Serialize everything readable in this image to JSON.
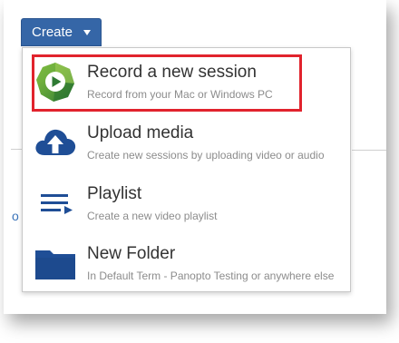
{
  "create_button": {
    "label": "Create"
  },
  "menu": {
    "items": [
      {
        "title": "Record a new session",
        "subtitle": "Record from your Mac or Windows PC",
        "icon": "panopto-play-icon"
      },
      {
        "title": "Upload media",
        "subtitle": "Create new sessions by uploading video or audio",
        "icon": "cloud-upload-icon"
      },
      {
        "title": "Playlist",
        "subtitle": "Create a new video playlist",
        "icon": "playlist-icon"
      },
      {
        "title": "New Folder",
        "subtitle": "In Default Term - Panopto Testing or anywhere else",
        "icon": "folder-icon"
      }
    ]
  },
  "background": {
    "fragment": "o"
  },
  "colors": {
    "button_blue": "#3566a7",
    "icon_blue": "#1f4e96",
    "highlight_red": "#e1232d",
    "panopto_green": "#4e9a3a"
  }
}
